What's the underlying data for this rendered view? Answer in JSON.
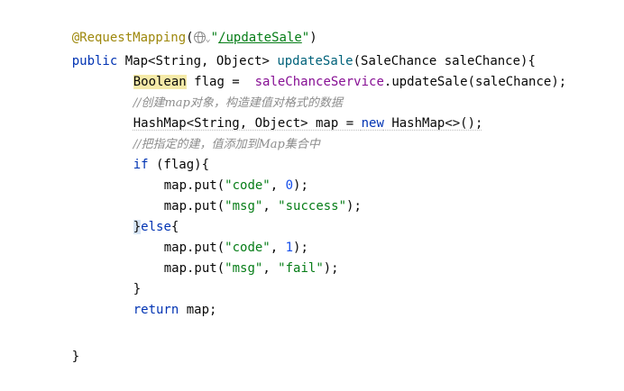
{
  "code": {
    "l1": {
      "annotation": "@RequestMapping",
      "paren_open": "(",
      "chevron": "⌄",
      "quote_open": "\"",
      "url": "/updateSale",
      "quote_close": "\"",
      "paren_close": ")"
    },
    "l2": {
      "kw_public": "public",
      "sig_a": " Map<String, Object> ",
      "method": "updateSale",
      "sig_b": "(SaleChance saleChance){"
    },
    "l3": {
      "type": "Boolean",
      "a": " flag =  ",
      "service": "saleChanceService",
      "b": ".updateSale(saleChance);"
    },
    "l4": {
      "comment": "//创建map对象，构造建值对格式的数据"
    },
    "l5": {
      "a": "HashMap<String, Object> map = ",
      "kw_new": "new",
      "b": " HashMap<>();"
    },
    "l6": {
      "comment": "//把指定的建，值添加到Map集合中"
    },
    "l7": {
      "kw_if": "if",
      "rest": " (flag){"
    },
    "l8": {
      "a": "map.put(",
      "key": "\"code\"",
      "sep": ", ",
      "num": "0",
      "end": ");"
    },
    "l9": {
      "a": "map.put(",
      "key": "\"msg\"",
      "sep": ", ",
      "val": "\"success\"",
      "end": ");"
    },
    "l10": {
      "brace": "}",
      "kw_else": "else",
      "rest": "{"
    },
    "l11": {
      "a": "map.put(",
      "key": "\"code\"",
      "sep": ", ",
      "num": "1",
      "end": ");"
    },
    "l12": {
      "a": "map.put(",
      "key": "\"msg\"",
      "sep": ", ",
      "val": "\"fail\"",
      "end": ");"
    },
    "l13": {
      "text": "}"
    },
    "l14": {
      "kw_return": "return",
      "rest": " map;"
    },
    "l16": {
      "text": "}"
    }
  }
}
